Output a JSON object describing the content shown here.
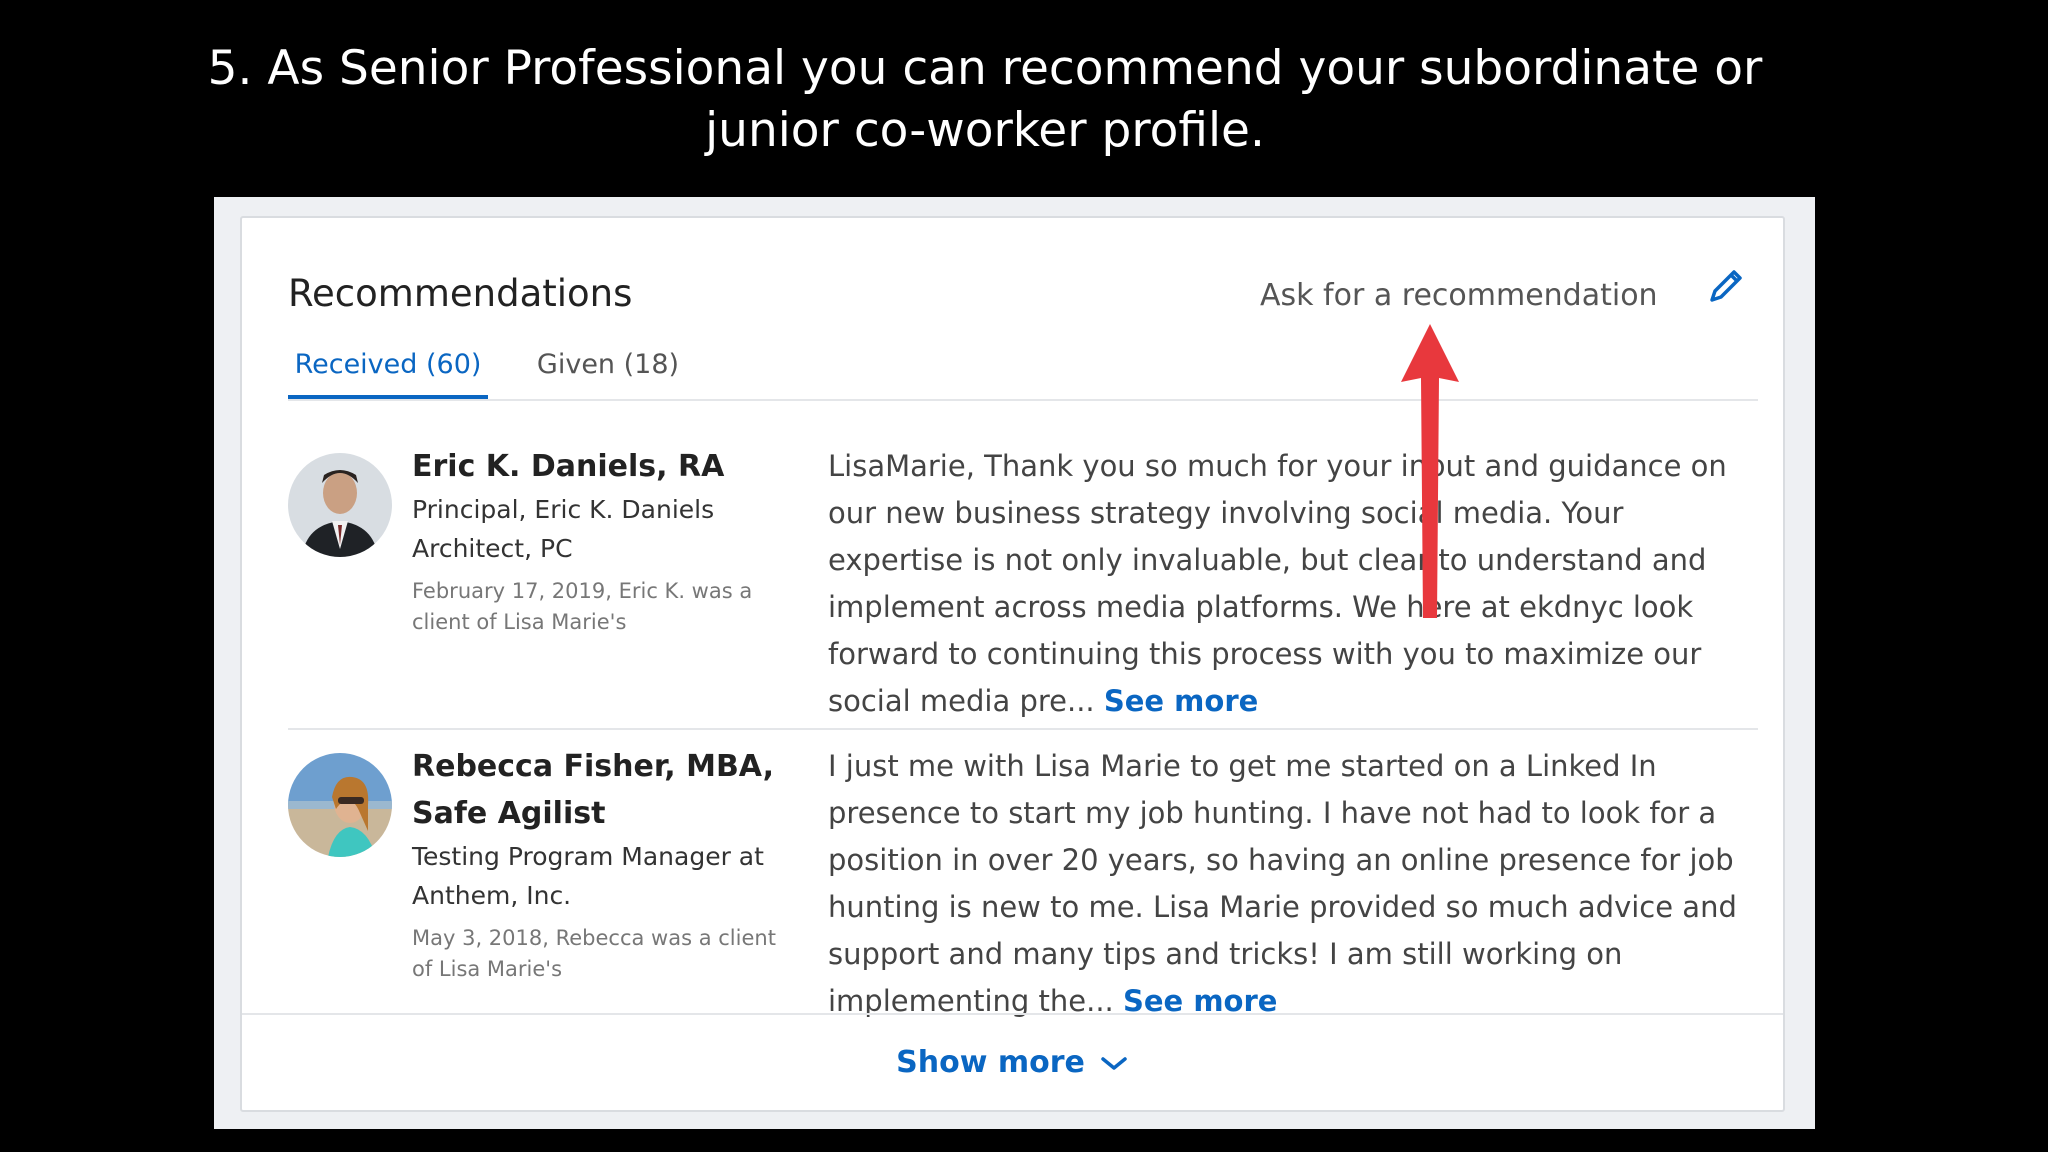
{
  "slide": {
    "title_line1": "5. As Senior Professional you can recommend your subordinate or",
    "title_line2": "junior co-worker profile."
  },
  "header": {
    "title": "Recommendations",
    "ask_link": "Ask for a recommendation",
    "edit_icon": "pencil-icon"
  },
  "tabs": [
    {
      "label": "Received (60)",
      "active": true
    },
    {
      "label": "Given (18)",
      "active": false
    }
  ],
  "recommendations": [
    {
      "name": "Eric K. Daniels, RA",
      "title": "Principal, Eric K. Daniels Architect, PC",
      "relation": "February 17, 2019, Eric K. was a client of Lisa Marie's",
      "text": "LisaMarie, Thank you so much for your input and guidance on our new business strategy involving social media. Your expertise is not only invaluable, but clear to understand and implement across media platforms. We here at ekdnyc look forward to continuing this process with you to maximize our social media pre...",
      "see_more": "See more"
    },
    {
      "name": "Rebecca Fisher, MBA, Safe Agilist",
      "title": "Testing Program Manager at Anthem, Inc.",
      "relation": "May 3, 2018, Rebecca was a client of Lisa Marie's",
      "text": "I just me with Lisa Marie to get me started on a Linked In presence to start my job hunting. I have not had to look for a position in over 20 years, so having an online presence for job hunting is new to me. Lisa Marie provided so much advice and support and many tips and tricks! I am still working on implementing the...",
      "see_more": "See more"
    }
  ],
  "footer": {
    "show_more": "Show more",
    "chevron_icon": "chevron-down-icon"
  },
  "colors": {
    "accent": "#0a66c2",
    "arrow": "#e8383d"
  }
}
